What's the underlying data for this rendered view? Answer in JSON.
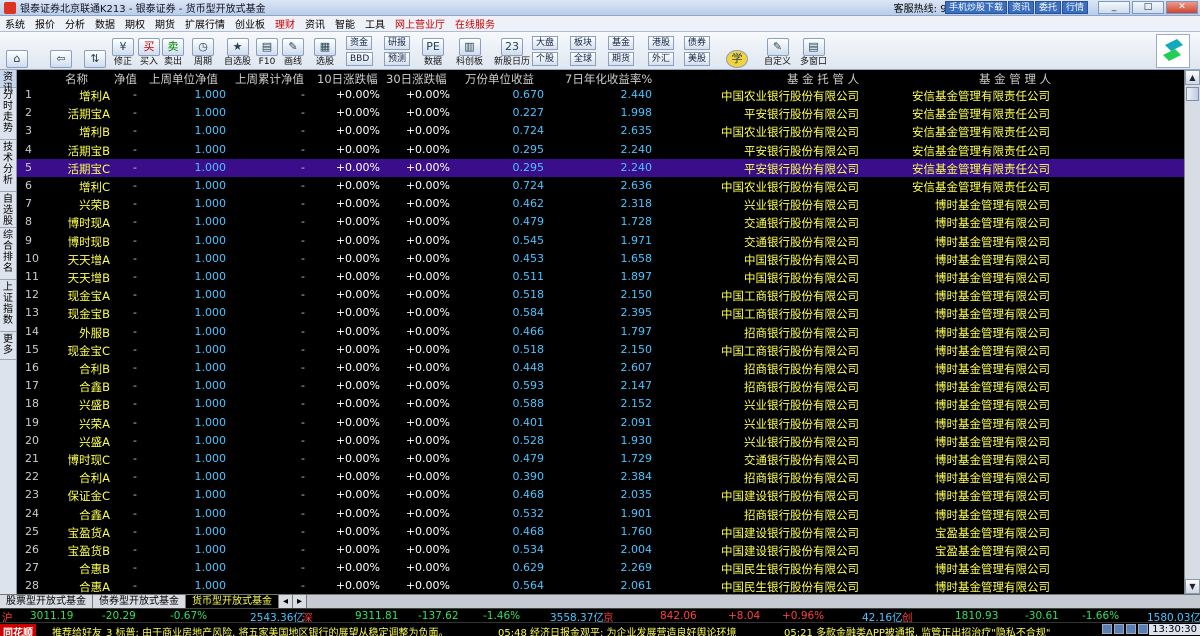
{
  "window": {
    "title": "银泰证券北京联通K213 - 银泰证券 - 货币型开放式基金",
    "hotline_label": "客服热线:",
    "hotline": "95341",
    "buttons": [
      "手机炒股下载",
      "资讯",
      "委托",
      "行情"
    ],
    "controls": [
      "_",
      "□",
      "✕"
    ]
  },
  "menu": [
    "系统",
    "报价",
    "分析",
    "数据",
    "期权",
    "期货",
    "扩展行情",
    "创业板",
    "理财",
    "资讯",
    "智能",
    "工具",
    "网上营业厅",
    "在线服务"
  ],
  "menu_red": [
    "理财",
    "网上营业厅",
    "在线服务"
  ],
  "toolbar": {
    "big": [
      {
        "icon": "home-icon",
        "glyph": "⌂",
        "label": ""
      },
      {
        "icon": "back-icon",
        "glyph": "⇦",
        "label": ""
      },
      {
        "icon": "updown-icon",
        "glyph": "⇅",
        "label": ""
      },
      {
        "icon": "refresh-icon",
        "glyph": "¥",
        "label": "修正"
      },
      {
        "icon": "buy-icon",
        "glyph": "买",
        "label": "买入"
      },
      {
        "icon": "sell-icon",
        "glyph": "卖",
        "label": "卖出"
      },
      {
        "icon": "cycle-icon",
        "glyph": "◷",
        "label": "周期"
      },
      {
        "icon": "watchlist-icon",
        "glyph": "★",
        "label": "自选股"
      },
      {
        "icon": "f10-icon",
        "glyph": "▤",
        "label": "F10"
      },
      {
        "icon": "draw-icon",
        "glyph": "✎",
        "label": "画线"
      },
      {
        "icon": "stockpick-icon",
        "glyph": "▦",
        "label": "选股"
      },
      {
        "icon": "data-icon",
        "glyph": "PE",
        "label": "数据"
      },
      {
        "icon": "innovation-icon",
        "glyph": "▥",
        "label": "科创板"
      },
      {
        "icon": "newstock-icon",
        "glyph": "23",
        "label": "新股日历"
      },
      {
        "icon": "tech-icon",
        "glyph": "学",
        "label": ""
      },
      {
        "icon": "custom-icon",
        "glyph": "✎",
        "label": "自定义"
      },
      {
        "icon": "multiwindow-icon",
        "glyph": "▤",
        "label": "多窗口"
      }
    ],
    "mini": [
      "资金",
      "BBD",
      "研报",
      "预测",
      "大盘",
      "个股",
      "板块",
      "全球",
      "基金",
      "期货",
      "港股",
      "外汇",
      "债券",
      "美股"
    ]
  },
  "sidebar": [
    "资讯",
    "分时走势",
    "技术分析",
    "自选股",
    "综合排名",
    "上证指数",
    "更多"
  ],
  "columns": {
    "name": "名称",
    "nav": "净值",
    "prev_nav": "上周单位净值",
    "prev_acc": "上周累计净值",
    "d10": "10日涨跌幅",
    "d30": "30日涨跌幅",
    "wf": "万份单位收益",
    "nh": "7日年化收益率%",
    "tg": "基 金 托 管 人",
    "gl": "基 金 管 理 人"
  },
  "rows": [
    {
      "no": "1",
      "name": "增利A",
      "nav": "-",
      "prev": "1.000",
      "acc": "-",
      "d10": "+0.00%",
      "d30": "+0.00%",
      "wf": "0.670",
      "nh": "2.440",
      "tg": "中国农业银行股份有限公司",
      "gl": "安信基金管理有限责任公司"
    },
    {
      "no": "2",
      "name": "活期宝A",
      "nav": "-",
      "prev": "1.000",
      "acc": "-",
      "d10": "+0.00%",
      "d30": "+0.00%",
      "wf": "0.227",
      "nh": "1.998",
      "tg": "平安银行股份有限公司",
      "gl": "安信基金管理有限责任公司"
    },
    {
      "no": "3",
      "name": "增利B",
      "nav": "-",
      "prev": "1.000",
      "acc": "-",
      "d10": "+0.00%",
      "d30": "+0.00%",
      "wf": "0.724",
      "nh": "2.635",
      "tg": "中国农业银行股份有限公司",
      "gl": "安信基金管理有限责任公司"
    },
    {
      "no": "4",
      "name": "活期宝B",
      "nav": "-",
      "prev": "1.000",
      "acc": "-",
      "d10": "+0.00%",
      "d30": "+0.00%",
      "wf": "0.295",
      "nh": "2.240",
      "tg": "平安银行股份有限公司",
      "gl": "安信基金管理有限责任公司"
    },
    {
      "no": "5",
      "name": "活期宝C",
      "nav": "-",
      "prev": "1.000",
      "acc": "-",
      "d10": "+0.00%",
      "d30": "+0.00%",
      "wf": "0.295",
      "nh": "2.240",
      "tg": "平安银行股份有限公司",
      "gl": "安信基金管理有限责任公司"
    },
    {
      "no": "6",
      "name": "增利C",
      "nav": "-",
      "prev": "1.000",
      "acc": "-",
      "d10": "+0.00%",
      "d30": "+0.00%",
      "wf": "0.724",
      "nh": "2.636",
      "tg": "中国农业银行股份有限公司",
      "gl": "安信基金管理有限责任公司"
    },
    {
      "no": "7",
      "name": "兴荣B",
      "nav": "-",
      "prev": "1.000",
      "acc": "-",
      "d10": "+0.00%",
      "d30": "+0.00%",
      "wf": "0.462",
      "nh": "2.318",
      "tg": "兴业银行股份有限公司",
      "gl": "博时基金管理有限公司"
    },
    {
      "no": "8",
      "name": "博时现A",
      "nav": "-",
      "prev": "1.000",
      "acc": "-",
      "d10": "+0.00%",
      "d30": "+0.00%",
      "wf": "0.479",
      "nh": "1.728",
      "tg": "交通银行股份有限公司",
      "gl": "博时基金管理有限公司"
    },
    {
      "no": "9",
      "name": "博时现B",
      "nav": "-",
      "prev": "1.000",
      "acc": "-",
      "d10": "+0.00%",
      "d30": "+0.00%",
      "wf": "0.545",
      "nh": "1.971",
      "tg": "交通银行股份有限公司",
      "gl": "博时基金管理有限公司"
    },
    {
      "no": "10",
      "name": "天天增A",
      "nav": "-",
      "prev": "1.000",
      "acc": "-",
      "d10": "+0.00%",
      "d30": "+0.00%",
      "wf": "0.453",
      "nh": "1.658",
      "tg": "中国银行股份有限公司",
      "gl": "博时基金管理有限公司"
    },
    {
      "no": "11",
      "name": "天天增B",
      "nav": "-",
      "prev": "1.000",
      "acc": "-",
      "d10": "+0.00%",
      "d30": "+0.00%",
      "wf": "0.511",
      "nh": "1.897",
      "tg": "中国银行股份有限公司",
      "gl": "博时基金管理有限公司"
    },
    {
      "no": "12",
      "name": "现金宝A",
      "nav": "-",
      "prev": "1.000",
      "acc": "-",
      "d10": "+0.00%",
      "d30": "+0.00%",
      "wf": "0.518",
      "nh": "2.150",
      "tg": "中国工商银行股份有限公司",
      "gl": "博时基金管理有限公司"
    },
    {
      "no": "13",
      "name": "现金宝B",
      "nav": "-",
      "prev": "1.000",
      "acc": "-",
      "d10": "+0.00%",
      "d30": "+0.00%",
      "wf": "0.584",
      "nh": "2.395",
      "tg": "中国工商银行股份有限公司",
      "gl": "博时基金管理有限公司"
    },
    {
      "no": "14",
      "name": "外服B",
      "nav": "-",
      "prev": "1.000",
      "acc": "-",
      "d10": "+0.00%",
      "d30": "+0.00%",
      "wf": "0.466",
      "nh": "1.797",
      "tg": "招商银行股份有限公司",
      "gl": "博时基金管理有限公司"
    },
    {
      "no": "15",
      "name": "现金宝C",
      "nav": "-",
      "prev": "1.000",
      "acc": "-",
      "d10": "+0.00%",
      "d30": "+0.00%",
      "wf": "0.518",
      "nh": "2.150",
      "tg": "中国工商银行股份有限公司",
      "gl": "博时基金管理有限公司"
    },
    {
      "no": "16",
      "name": "合利B",
      "nav": "-",
      "prev": "1.000",
      "acc": "-",
      "d10": "+0.00%",
      "d30": "+0.00%",
      "wf": "0.448",
      "nh": "2.607",
      "tg": "招商银行股份有限公司",
      "gl": "博时基金管理有限公司"
    },
    {
      "no": "17",
      "name": "合鑫B",
      "nav": "-",
      "prev": "1.000",
      "acc": "-",
      "d10": "+0.00%",
      "d30": "+0.00%",
      "wf": "0.593",
      "nh": "2.147",
      "tg": "招商银行股份有限公司",
      "gl": "博时基金管理有限公司"
    },
    {
      "no": "18",
      "name": "兴盛B",
      "nav": "-",
      "prev": "1.000",
      "acc": "-",
      "d10": "+0.00%",
      "d30": "+0.00%",
      "wf": "0.588",
      "nh": "2.152",
      "tg": "兴业银行股份有限公司",
      "gl": "博时基金管理有限公司"
    },
    {
      "no": "19",
      "name": "兴荣A",
      "nav": "-",
      "prev": "1.000",
      "acc": "-",
      "d10": "+0.00%",
      "d30": "+0.00%",
      "wf": "0.401",
      "nh": "2.091",
      "tg": "兴业银行股份有限公司",
      "gl": "博时基金管理有限公司"
    },
    {
      "no": "20",
      "name": "兴盛A",
      "nav": "-",
      "prev": "1.000",
      "acc": "-",
      "d10": "+0.00%",
      "d30": "+0.00%",
      "wf": "0.528",
      "nh": "1.930",
      "tg": "兴业银行股份有限公司",
      "gl": "博时基金管理有限公司"
    },
    {
      "no": "21",
      "name": "博时现C",
      "nav": "-",
      "prev": "1.000",
      "acc": "-",
      "d10": "+0.00%",
      "d30": "+0.00%",
      "wf": "0.479",
      "nh": "1.729",
      "tg": "交通银行股份有限公司",
      "gl": "博时基金管理有限公司"
    },
    {
      "no": "22",
      "name": "合利A",
      "nav": "-",
      "prev": "1.000",
      "acc": "-",
      "d10": "+0.00%",
      "d30": "+0.00%",
      "wf": "0.390",
      "nh": "2.384",
      "tg": "招商银行股份有限公司",
      "gl": "博时基金管理有限公司"
    },
    {
      "no": "23",
      "name": "保证金C",
      "nav": "-",
      "prev": "1.000",
      "acc": "-",
      "d10": "+0.00%",
      "d30": "+0.00%",
      "wf": "0.468",
      "nh": "2.035",
      "tg": "中国建设银行股份有限公司",
      "gl": "博时基金管理有限公司"
    },
    {
      "no": "24",
      "name": "合鑫A",
      "nav": "-",
      "prev": "1.000",
      "acc": "-",
      "d10": "+0.00%",
      "d30": "+0.00%",
      "wf": "0.532",
      "nh": "1.901",
      "tg": "招商银行股份有限公司",
      "gl": "博时基金管理有限公司"
    },
    {
      "no": "25",
      "name": "宝盈货A",
      "nav": "-",
      "prev": "1.000",
      "acc": "-",
      "d10": "+0.00%",
      "d30": "+0.00%",
      "wf": "0.468",
      "nh": "1.760",
      "tg": "中国建设银行股份有限公司",
      "gl": "宝盈基金管理有限公司"
    },
    {
      "no": "26",
      "name": "宝盈货B",
      "nav": "-",
      "prev": "1.000",
      "acc": "-",
      "d10": "+0.00%",
      "d30": "+0.00%",
      "wf": "0.534",
      "nh": "2.004",
      "tg": "中国建设银行股份有限公司",
      "gl": "宝盈基金管理有限公司"
    },
    {
      "no": "27",
      "name": "合惠B",
      "nav": "-",
      "prev": "1.000",
      "acc": "-",
      "d10": "+0.00%",
      "d30": "+0.00%",
      "wf": "0.629",
      "nh": "2.269",
      "tg": "中国民生银行股份有限公司",
      "gl": "博时基金管理有限公司"
    },
    {
      "no": "28",
      "name": "合惠A",
      "nav": "-",
      "prev": "1.000",
      "acc": "-",
      "d10": "+0.00%",
      "d30": "+0.00%",
      "wf": "0.564",
      "nh": "2.061",
      "tg": "中国民生银行股份有限公司",
      "gl": "博时基金管理有限公司"
    }
  ],
  "selected_row": "5",
  "tabs": [
    "股票型开放式基金",
    "债券型开放式基金",
    "货币型开放式基金"
  ],
  "active_tab": "货币型开放式基金",
  "market": {
    "sh_label": "沪",
    "sh": "3011.19",
    "sh_chg": "-20.29",
    "sh_pct": "-0.67%",
    "sh_amt": "2543.36亿",
    "sz_label": "深",
    "sz": "9311.81",
    "sz_chg": "-137.62",
    "sz_pct": "-1.46%",
    "sz_amt": "3558.37亿",
    "jing_label": "京",
    "jing": "842.06",
    "jing_chg": "+8.04",
    "jing_pct": "+0.96%",
    "jing_amt": "42.16亿",
    "cy_label": "创",
    "cy": "1810.93",
    "cy_chg": "-30.61",
    "cy_pct": "-1.66%",
    "cy_amt": "1580.03亿"
  },
  "ticker": {
    "brand": "同花顺",
    "recommend": "推荐给好友",
    "news1": "3 标普: 由于商业房地产风险, 将五家美国地区银行的展望从稳定调整为负面。",
    "news2": "05:48 经济日报金观平: 为企业发展营造良好舆论环境",
    "news3": "05:21 多款金融类APP被通报, 监管正出招治疗\"隐私不合规\"",
    "clock": "13:30:30"
  }
}
